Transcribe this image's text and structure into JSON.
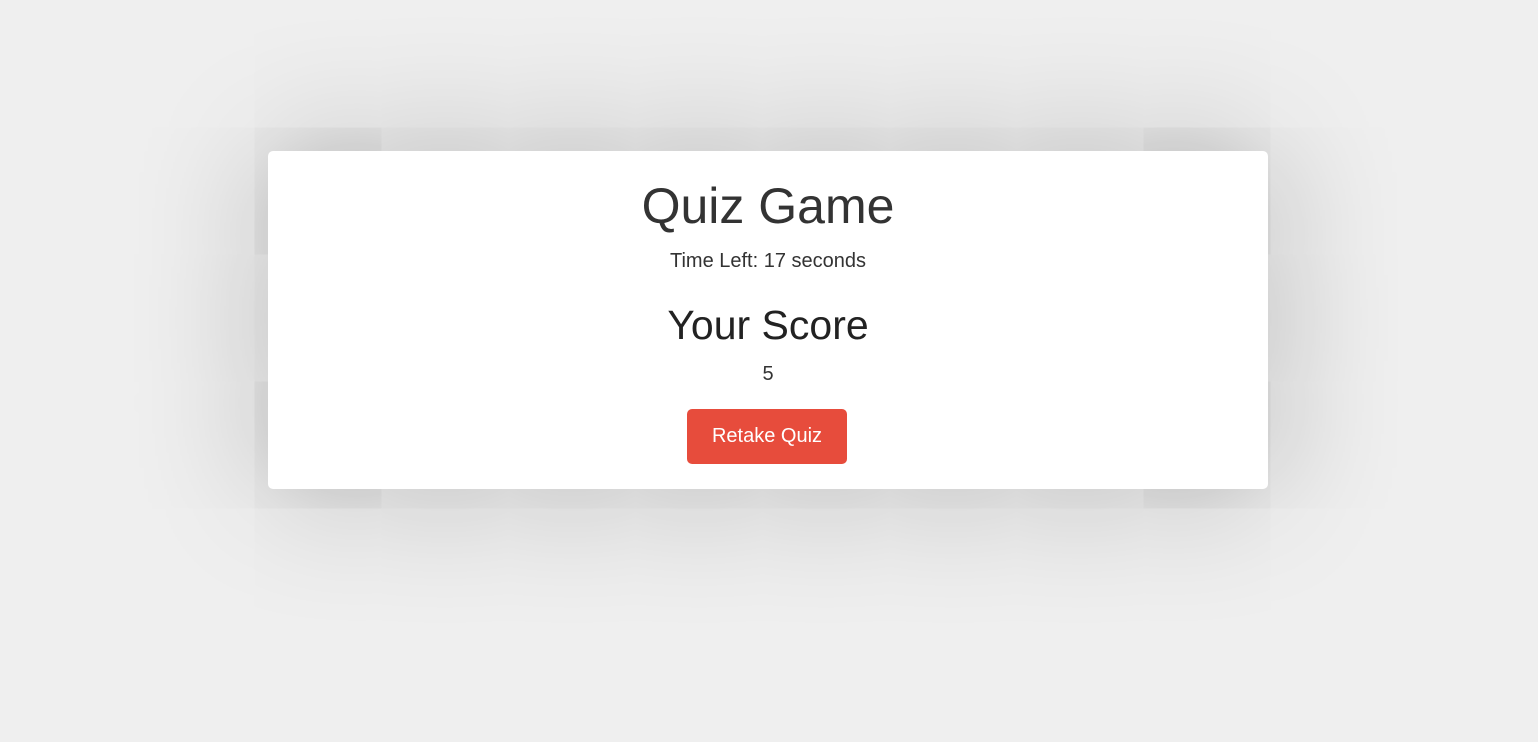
{
  "quiz": {
    "title": "Quiz Game",
    "timer_text": "Time Left: 17 seconds",
    "score_heading": "Your Score",
    "score_value": "5",
    "retake_label": "Retake Quiz"
  },
  "colors": {
    "background": "#efefef",
    "card": "#ffffff",
    "accent_button": "#e74c3c",
    "text": "#333333"
  }
}
